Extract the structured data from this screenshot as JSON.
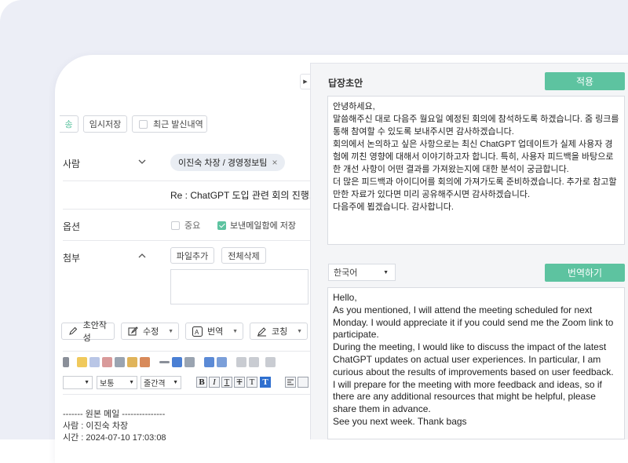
{
  "compose": {
    "send_partial": "송",
    "save_draft": "임시저장",
    "recent_sent": "최근 발신내역",
    "recipient_label": "사람",
    "recipient_chip": "이진숙 차장 / 경영정보팀",
    "subject": "Re : ChatGPT 도입 관련 회의 진행.",
    "options_label": "옵션",
    "option_important": "중요",
    "option_save_sent": "보낸메일함에 저장",
    "attach_label": "첨부",
    "attach_add": "파일추가",
    "attach_delete_all": "전체삭제"
  },
  "ai_toolbar": {
    "draft": "초안작성",
    "edit": "수정",
    "translate": "번역",
    "coach": "코칭"
  },
  "editor": {
    "font_size": "보통",
    "line_height": "줄간격",
    "format_buttons": [
      "B",
      "I",
      "T",
      "T",
      "T",
      "T"
    ]
  },
  "original": {
    "header": "------- 원본 메일 ---------------",
    "from": "사람 : 이진숙 차장",
    "time": "시간 : 2024-07-10 17:03:08"
  },
  "panel": {
    "title": "답장초안",
    "apply": "적용",
    "draft_text": "안녕하세요,\n말씀해주신 대로 다음주 월요일 예정된 회의에 참석하도록 하겠습니다. 줌 링크를 통해 참여할 수 있도록 보내주시면 감사하겠습니다.\n회의에서 논의하고 싶은 사항으로는 최신 ChatGPT 업데이트가 실제 사용자 경험에 끼친 영향에 대해서 이야기하고자 합니다. 특히, 사용자 피드백을 바탕으로 한 개선 사항이 어떤 결과를 가져왔는지에 대한 분석이 궁금합니다.\n더 많은 피드백과 아이디어를 회의에 가져가도록 준비하겠습니다. 추가로 참고할 만한 자료가 있다면 미리 공유해주시면 감사하겠습니다.\n다음주에 뵙겠습니다. 감사합니다.",
    "language": "한국어",
    "translate_btn": "번역하기",
    "translation": "Hello,\nAs you mentioned, I will attend the meeting scheduled for next Monday. I would appreciate it if you could send me the Zoom link to participate.\nDuring the meeting, I would like to discuss the impact of the latest ChatGPT updates on actual user experiences. In particular, I am curious about the results of improvements based on user feedback.\nI will prepare for the meeting with more feedback and ideas, so if there are any additional resources that might be helpful, please share them in advance.\nSee you next week. Thank bags"
  },
  "colors": {
    "accent": "#5dc3a0",
    "background": "#eceef6",
    "panel": "#f4f5f7"
  }
}
